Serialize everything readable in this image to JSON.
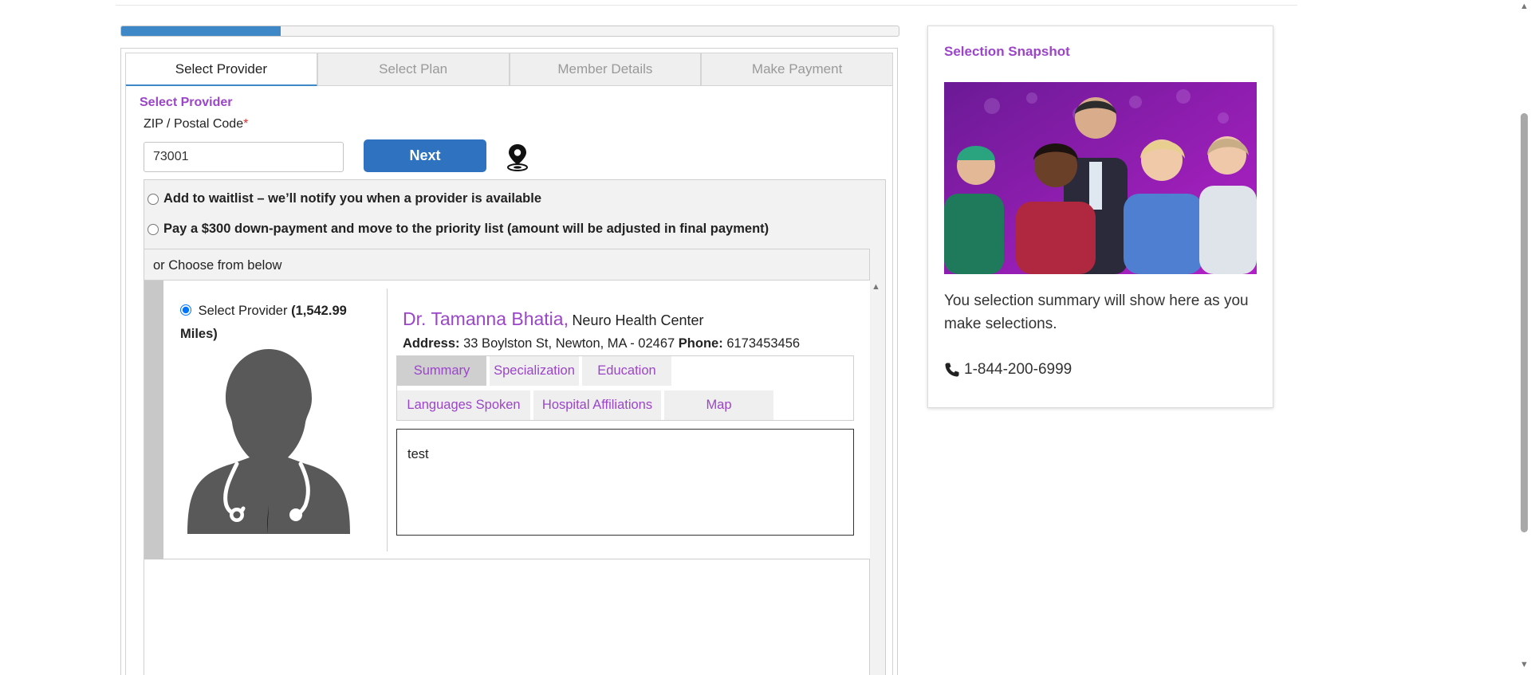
{
  "progress": {
    "fraction": 0.205
  },
  "wizard": {
    "tabs": [
      {
        "label": "Select Provider",
        "active": true
      },
      {
        "label": "Select Plan",
        "active": false
      },
      {
        "label": "Member Details",
        "active": false
      },
      {
        "label": "Make Payment",
        "active": false
      }
    ]
  },
  "provider_step": {
    "section_title": "Select Provider",
    "zip_label": "ZIP / Postal Code",
    "zip_required_mark": "*",
    "zip_value": "73001",
    "next_label": "Next",
    "location_icon": "map-pin-icon",
    "option_waitlist": "Add to waitlist – we’ll notify you when a provider is available",
    "option_priority": "Pay a $300 down-payment and move to the priority list (amount will be adjusted in final payment)",
    "choose_label": "or Choose from below"
  },
  "provider_card": {
    "select_label": "Select Provider",
    "distance": "(1,542.99 Miles)",
    "avatar_icon": "doctor-silhouette-icon",
    "doctor_name": "Dr. Tamanna Bhatia,",
    "center_name": "Neuro Health Center",
    "address_label": "Address:",
    "address_value": "33 Boylston St, Newton, MA - 02467",
    "phone_label": "Phone:",
    "phone_value": "6173453456",
    "info_tabs": [
      {
        "label": "Summary",
        "active": true
      },
      {
        "label": "Specialization",
        "active": false
      },
      {
        "label": "Education",
        "active": false
      },
      {
        "label": "Languages Spoken",
        "active": false
      },
      {
        "label": "Hospital Affiliations",
        "active": false
      },
      {
        "label": "Map",
        "active": false
      }
    ],
    "info_content": "test"
  },
  "snapshot": {
    "title": "Selection Snapshot",
    "image_icon": "healthcare-team-photo",
    "summary_text": "You selection summary will show here as you make selections.",
    "phone_icon": "phone-icon",
    "phone_number": "1-844-200-6999"
  },
  "colors": {
    "accent_purple": "#9b45c9",
    "primary_blue": "#2f72bf",
    "progress_blue": "#3f88c8"
  }
}
